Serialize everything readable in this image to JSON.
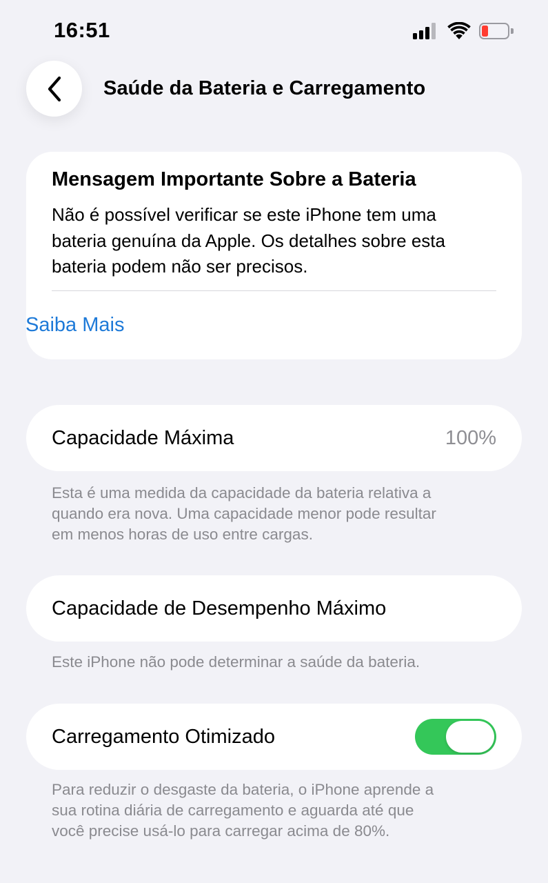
{
  "status_bar": {
    "time": "16:51",
    "icons": [
      "cellular-signal-icon",
      "wifi-icon",
      "battery-low-icon"
    ],
    "battery_color": "#ff3b30"
  },
  "nav": {
    "back_icon": "chevron-left-icon",
    "title": "Saúde da Bateria e Carregamento"
  },
  "message_card": {
    "title": "Mensagem Importante Sobre a Bateria",
    "lines": [
      "Não é possível verificar se este iPhone tem uma",
      "bateria genuína da Apple. Os detalhes sobre esta",
      "bateria podem não ser precisos."
    ],
    "link_label": "Saiba Mais",
    "link_color": "#1e7ad8"
  },
  "max_capacity": {
    "label": "Capacidade Máxima",
    "value": "100%",
    "footnote_lines": [
      "Esta é uma medida da capacidade da bateria relativa a",
      "quando era nova. Uma capacidade menor pode resultar",
      "em menos horas de uso entre cargas."
    ]
  },
  "peak_performance": {
    "label": "Capacidade de Desempenho Máximo",
    "footnote": "Este iPhone não pode determinar a saúde da bateria."
  },
  "optimized_charging": {
    "label": "Carregamento Otimizado",
    "enabled": true,
    "toggle_color": "#34c759",
    "footnote_lines": [
      "Para reduzir o desgaste da bateria, o iPhone aprende a",
      "sua rotina diária de carregamento e aguarda até que",
      "você precise usá-lo para carregar acima de 80%."
    ]
  }
}
